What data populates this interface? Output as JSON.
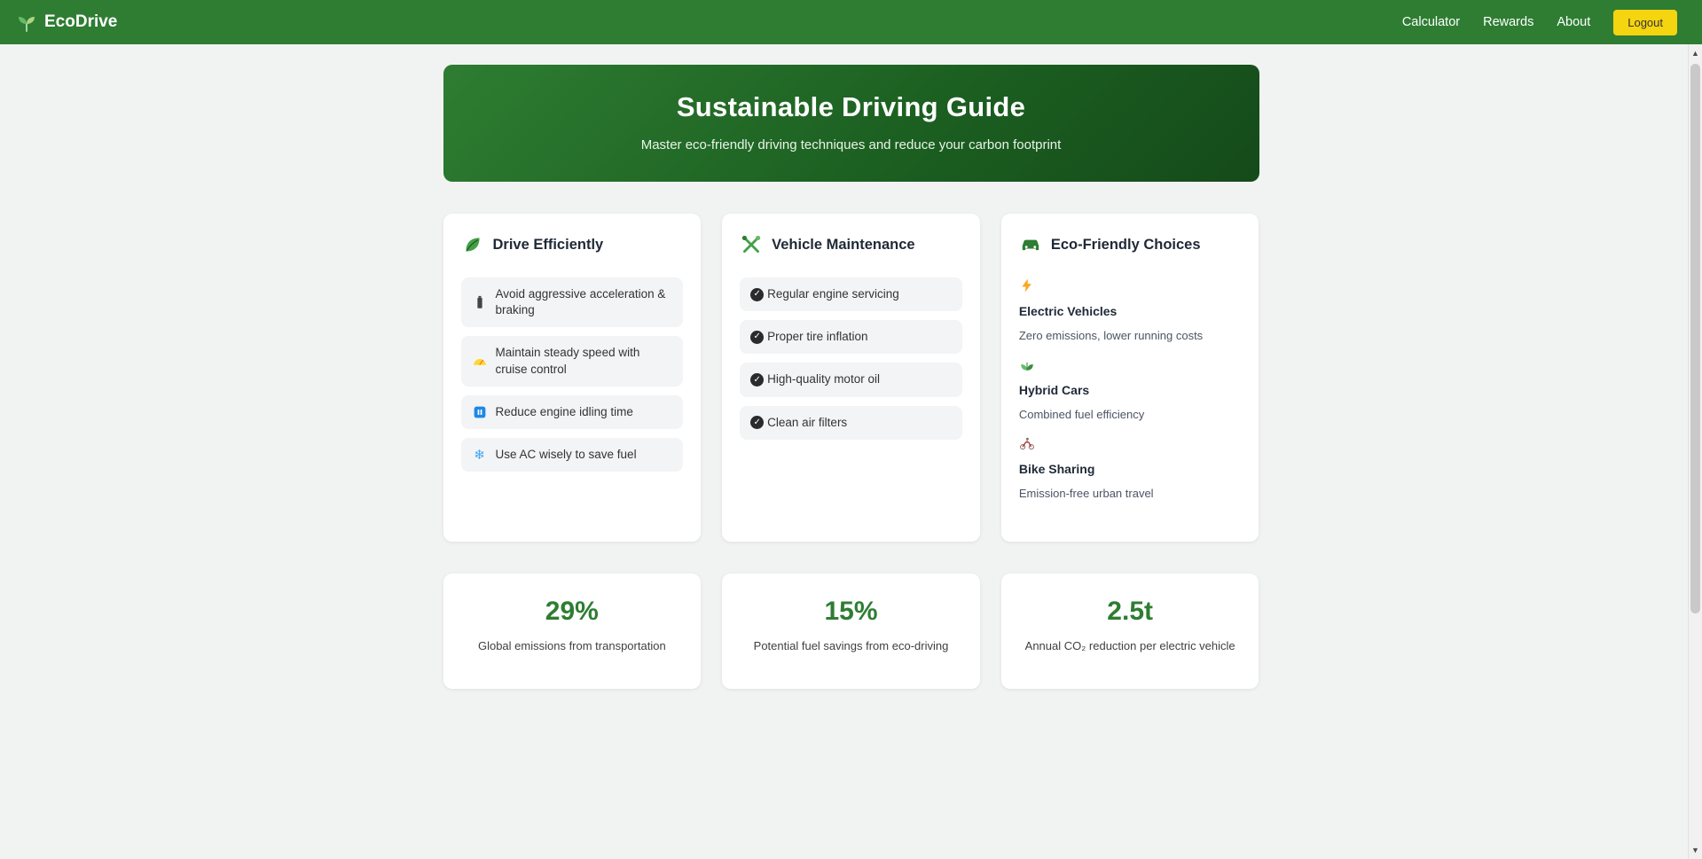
{
  "header": {
    "brand": "EcoDrive",
    "brand_icon": "seedling-icon",
    "nav": [
      {
        "label": "Calculator"
      },
      {
        "label": "Rewards"
      },
      {
        "label": "About"
      }
    ],
    "logout_label": "Logout"
  },
  "hero": {
    "title": "Sustainable Driving Guide",
    "subtitle": "Master eco-friendly driving techniques and reduce your carbon footprint"
  },
  "cards": [
    {
      "title": "Drive Efficiently",
      "icon": "leaf-icon",
      "items": [
        {
          "icon": "battery-icon",
          "text": "Avoid aggressive acceleration & braking"
        },
        {
          "icon": "cruise-gauge-icon",
          "text": "Maintain steady speed with cruise control"
        },
        {
          "icon": "pause-icon",
          "text": "Reduce engine idling time"
        },
        {
          "icon": "snowflake-icon",
          "text": "Use AC wisely to save fuel"
        }
      ]
    },
    {
      "title": "Vehicle Maintenance",
      "icon": "tools-icon",
      "items": [
        {
          "icon": "check-circle-icon",
          "text": "Regular engine servicing"
        },
        {
          "icon": "check-circle-icon",
          "text": "Proper tire inflation"
        },
        {
          "icon": "check-circle-icon",
          "text": "High-quality motor oil"
        },
        {
          "icon": "check-circle-icon",
          "text": "Clean air filters"
        }
      ]
    },
    {
      "title": "Eco-Friendly Choices",
      "icon": "green-car-icon",
      "sections": [
        {
          "icon": "lightning-bolt-icon",
          "heading": "Electric Vehicles",
          "description": "Zero emissions, lower running costs"
        },
        {
          "icon": "herb-icon",
          "heading": "Hybrid Cars",
          "description": "Combined fuel efficiency"
        },
        {
          "icon": "cyclist-icon",
          "heading": "Bike Sharing",
          "description": "Emission-free urban travel"
        }
      ]
    }
  ],
  "stats": [
    {
      "value": "29%",
      "label": "Global emissions from transportation"
    },
    {
      "value": "15%",
      "label": "Potential fuel savings from eco-driving"
    },
    {
      "value": "2.5t",
      "label": "Annual CO₂ reduction per electric vehicle"
    }
  ],
  "icons": {
    "check_glyph": "✓",
    "snowflake_glyph": "❄",
    "scroll_up_glyph": "▲",
    "scroll_down_glyph": "▼"
  },
  "colors": {
    "navbar_green": "#2e7d32",
    "hero_gradient_start": "#2e7d32",
    "hero_gradient_end": "#154a1a",
    "logout_yellow": "#f5d410",
    "stat_green": "#2e7d32",
    "page_background": "#f1f3f2",
    "card_background": "#ffffff",
    "tip_row_background": "#f3f4f5"
  }
}
